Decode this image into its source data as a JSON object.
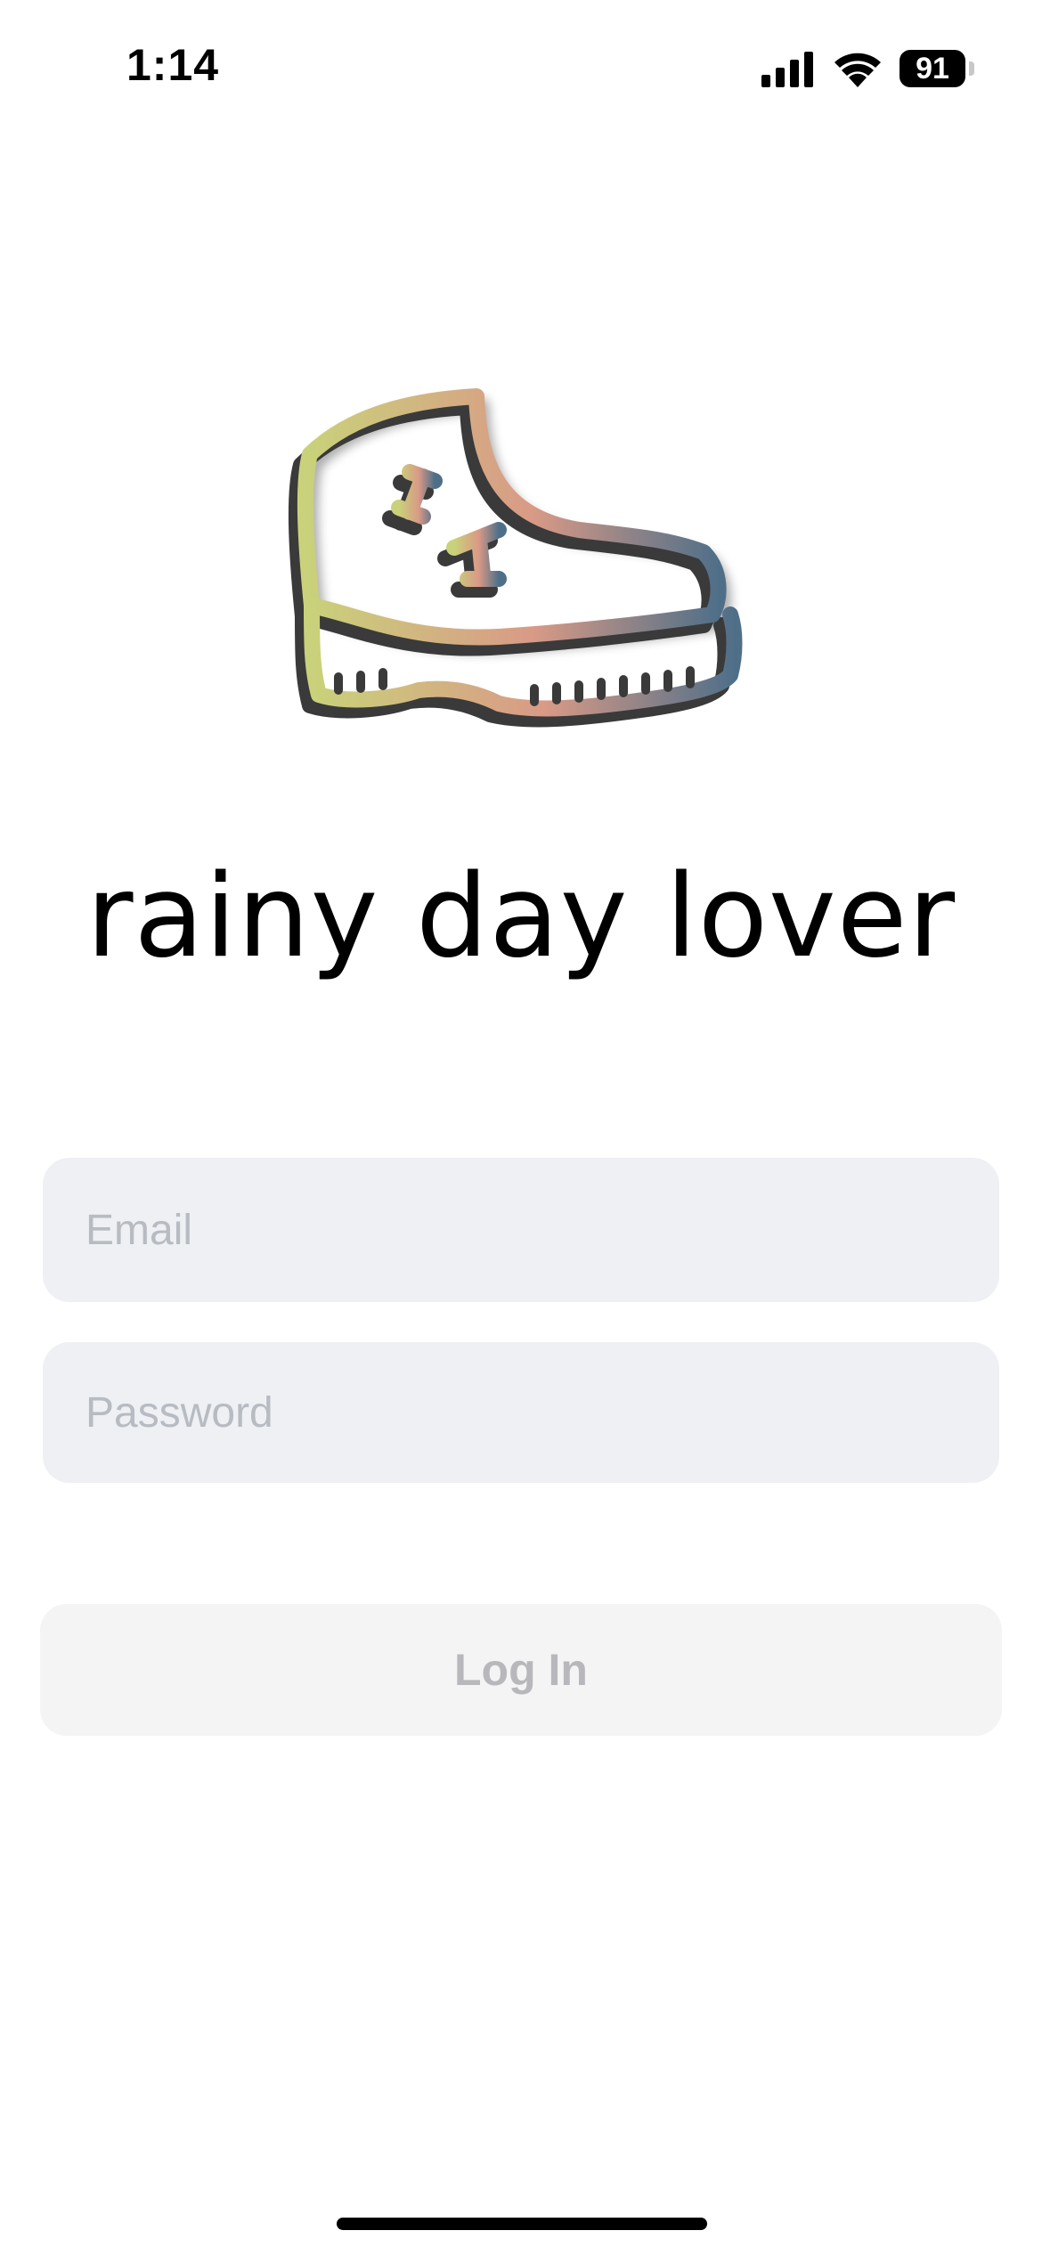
{
  "status_bar": {
    "time": "1:14",
    "battery_level": "91",
    "icons": [
      "signal-icon",
      "wifi-icon",
      "battery-icon"
    ]
  },
  "logo": {
    "icon": "boot-icon",
    "gradient_colors": [
      "#c9d27a",
      "#d99a86",
      "#4f6f89"
    ],
    "shadow_color": "#3a3a3a"
  },
  "app": {
    "title": "rainy day lover"
  },
  "form": {
    "email": {
      "placeholder": "Email",
      "value": ""
    },
    "password": {
      "placeholder": "Password",
      "value": ""
    },
    "login_label": "Log In"
  },
  "colors": {
    "field_background": "#eef0f3",
    "placeholder": "#b7bbc2",
    "button_background": "#f4f4f5",
    "button_text_disabled": "#b8b8bc"
  }
}
